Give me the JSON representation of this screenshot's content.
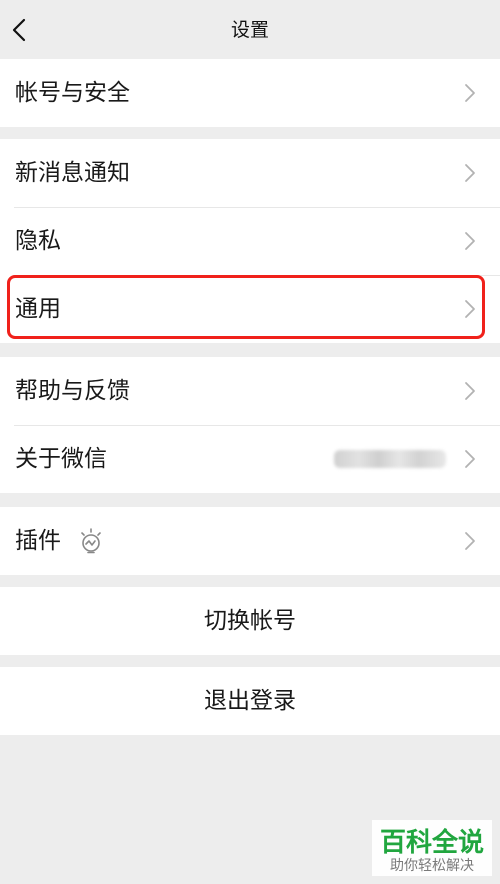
{
  "header": {
    "title": "设置",
    "back_icon": "chevron-left-icon"
  },
  "groups": [
    {
      "items": [
        {
          "label": "帐号与安全",
          "icon": "chevron-right-icon"
        }
      ]
    },
    {
      "items": [
        {
          "label": "新消息通知",
          "icon": "chevron-right-icon"
        },
        {
          "label": "隐私",
          "icon": "chevron-right-icon"
        },
        {
          "label": "通用",
          "icon": "chevron-right-icon",
          "highlighted": true
        }
      ]
    },
    {
      "items": [
        {
          "label": "帮助与反馈",
          "icon": "chevron-right-icon"
        },
        {
          "label": "关于微信",
          "icon": "chevron-right-icon",
          "value_blurred": true
        }
      ]
    },
    {
      "items": [
        {
          "label": "插件",
          "extra_icon": "lightbulb-icon",
          "icon": "chevron-right-icon"
        }
      ]
    }
  ],
  "actions": {
    "switch_account": "切换帐号",
    "logout": "退出登录"
  },
  "watermark": {
    "title": "百科全说",
    "subtitle": "助你轻松解决"
  },
  "colors": {
    "background": "#ededed",
    "row": "#ffffff",
    "highlight": "#f0211b",
    "watermark_green": "#21a63f"
  }
}
